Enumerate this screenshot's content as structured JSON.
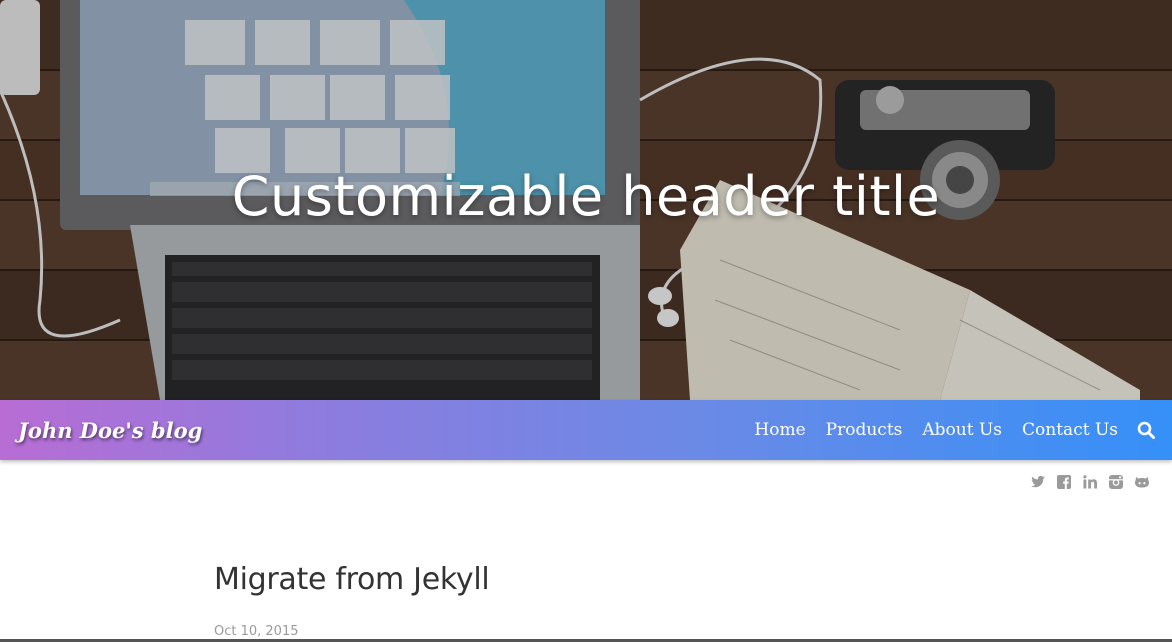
{
  "hero": {
    "title": "Customizable header title"
  },
  "navbar": {
    "brand": "John Doe's blog",
    "links": [
      {
        "label": "Home"
      },
      {
        "label": "Products"
      },
      {
        "label": "About Us"
      },
      {
        "label": "Contact Us"
      }
    ],
    "search_icon": "search-icon",
    "gradient_colors": [
      "#b86dd4",
      "#3590f8"
    ]
  },
  "social": {
    "icons": [
      "twitter-icon",
      "facebook-icon",
      "linkedin-icon",
      "instagram-icon",
      "github-icon"
    ],
    "color": "#9a9a9a"
  },
  "post": {
    "title": "Migrate from Jekyll",
    "date": "Oct 10, 2015"
  }
}
